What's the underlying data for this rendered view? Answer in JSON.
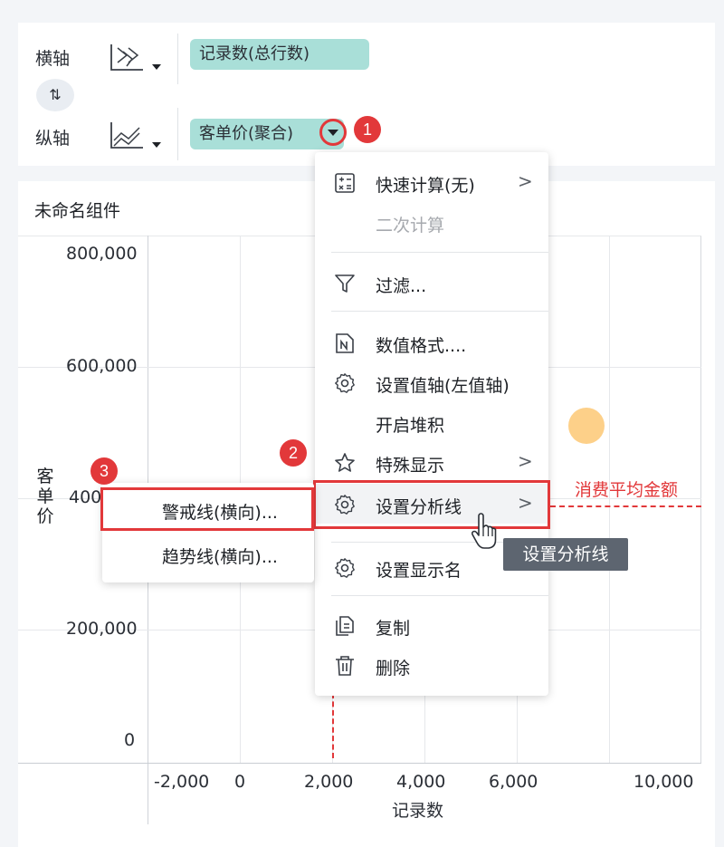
{
  "axes_panel": {
    "horizontal_label": "横轴",
    "vertical_label": "纵轴",
    "horizontal_field": "记录数(总行数)",
    "vertical_field": "客单价(聚合)",
    "swap_icon": "swap-vertical-icon",
    "horizontal_chart_icon": "scatter-chart-icon",
    "vertical_chart_icon": "line-chart-icon"
  },
  "component": {
    "title": "未命名组件",
    "chart_data": {
      "type": "scatter",
      "xlabel": "记录数",
      "ylabel": "客单价",
      "x_ticks": [
        "-2,000",
        "0",
        "2,000",
        "4,000",
        "6,000",
        "10,000"
      ],
      "y_ticks": [
        "800,000",
        "600,000",
        "400",
        "200,000",
        "0"
      ],
      "points": [
        {
          "x": 7500,
          "y": 500000
        }
      ],
      "reference_line_label": "消费平均金额",
      "reference_x": 2000,
      "point_color": "#fdd089",
      "reference_color": "#e2383a"
    }
  },
  "field_menu": {
    "items": [
      {
        "label": "快速计算(无)",
        "icon": "calculator-icon",
        "submenu": true
      },
      {
        "label": "二次计算",
        "disabled": true
      },
      {
        "label": "过滤...",
        "icon": "filter-icon"
      },
      {
        "label": "数值格式....",
        "icon": "number-format-icon"
      },
      {
        "label": "设置值轴(左值轴)",
        "icon": "gear-icon"
      },
      {
        "label": "开启堆积"
      },
      {
        "label": "特殊显示",
        "icon": "star-icon",
        "submenu": true
      },
      {
        "label": "设置分析线",
        "icon": "gear-icon",
        "submenu": true
      },
      {
        "label": "设置显示名",
        "icon": "gear-icon"
      },
      {
        "label": "复制",
        "icon": "copy-icon"
      },
      {
        "label": "删除",
        "icon": "trash-icon"
      }
    ],
    "submenu_arrow": ">"
  },
  "analysis_submenu": {
    "items": [
      "警戒线(横向)...",
      "趋势线(横向)..."
    ]
  },
  "tooltip": "设置分析线",
  "badges": [
    "1",
    "2",
    "3"
  ],
  "colors": {
    "accent_red": "#e2383a",
    "pill_teal": "#a9dfd8",
    "tooltip_bg": "#5d6570"
  }
}
